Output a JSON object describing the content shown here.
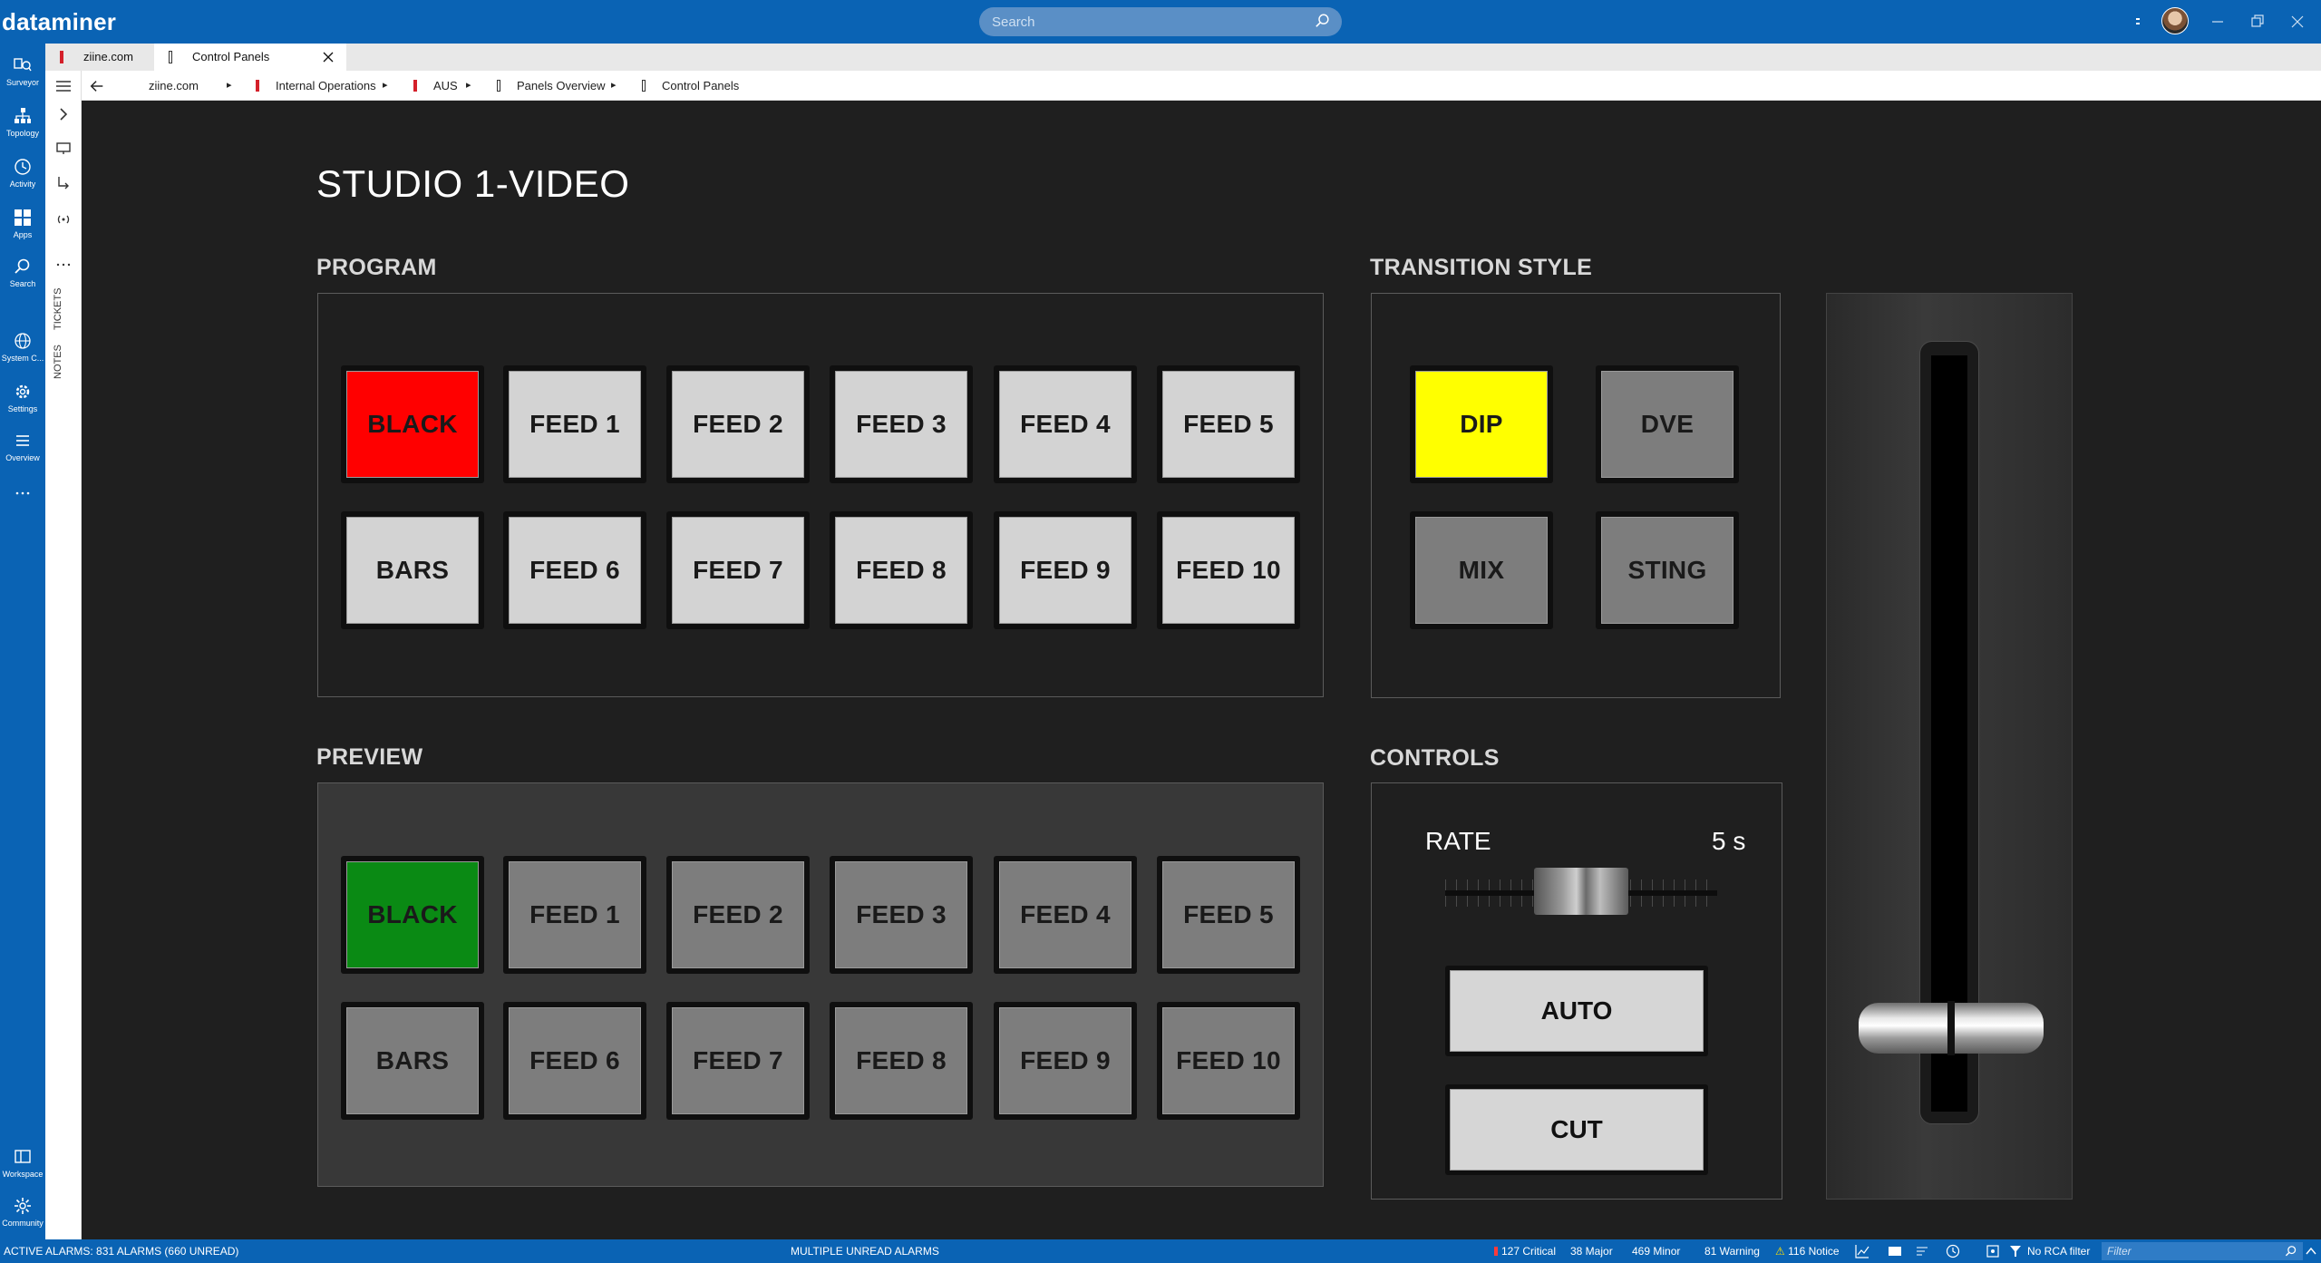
{
  "app": {
    "brand": "dataminer",
    "search_placeholder": "Search"
  },
  "nav": [
    {
      "label": "Surveyor",
      "icon": "surveyor-icon"
    },
    {
      "label": "Topology",
      "icon": "topology-icon"
    },
    {
      "label": "Activity",
      "icon": "activity-icon"
    },
    {
      "label": "Apps",
      "icon": "apps-icon"
    },
    {
      "label": "Search",
      "icon": "search-icon"
    },
    {
      "label": "System C...",
      "icon": "globe-icon"
    },
    {
      "label": "Settings",
      "icon": "gear-icon"
    },
    {
      "label": "Overview",
      "icon": "list-icon"
    },
    {
      "label": "Workspace",
      "icon": "workspace-icon"
    },
    {
      "label": "Community",
      "icon": "community-icon"
    }
  ],
  "strip": {
    "tickets": "TICKETS",
    "notes": "NOTES"
  },
  "tabs": [
    {
      "label": "ziine.com",
      "active": false
    },
    {
      "label": "Control Panels",
      "active": true
    }
  ],
  "breadcrumb": [
    "ziine.com",
    "Internal Operations",
    "AUS",
    "Panels Overview",
    "Control Panels"
  ],
  "page": {
    "title": "STUDIO 1-VIDEO",
    "program": {
      "title": "PROGRAM",
      "row1": [
        "BLACK",
        "FEED 1",
        "FEED 2",
        "FEED 3",
        "FEED 4",
        "FEED 5"
      ],
      "row2": [
        "BARS",
        "FEED 6",
        "FEED 7",
        "FEED 8",
        "FEED 9",
        "FEED 10"
      ],
      "active_color": "#ff0000"
    },
    "preview": {
      "title": "PREVIEW",
      "row1": [
        "BLACK",
        "FEED 1",
        "FEED 2",
        "FEED 3",
        "FEED 4",
        "FEED 5"
      ],
      "row2": [
        "BARS",
        "FEED 6",
        "FEED 7",
        "FEED 8",
        "FEED 9",
        "FEED 10"
      ],
      "active_color": "#0a8a14"
    },
    "transition": {
      "title": "TRANSITION STYLE",
      "buttons": [
        "DIP",
        "DVE",
        "MIX",
        "STING"
      ],
      "active_color": "#ffff00"
    },
    "controls": {
      "title": "CONTROLS",
      "rate_label": "RATE",
      "rate_value": "5 s",
      "auto": "AUTO",
      "cut": "CUT"
    }
  },
  "status": {
    "active_alarms": "ACTIVE ALARMS: 831 ALARMS (660 UNREAD)",
    "center": "MULTIPLE UNREAD ALARMS",
    "critical": "127 Critical",
    "major": "38 Major",
    "minor": "469 Minor",
    "warning": "81 Warning",
    "notice": "116 Notice",
    "rca": "No RCA filter",
    "filter_placeholder": "Filter",
    "colors": {
      "critical": "#ff3b3b",
      "major": "#ff9a3b",
      "minor": "#ffd83b",
      "warning": "#3bc6ff",
      "notice": "#ffe000"
    }
  }
}
